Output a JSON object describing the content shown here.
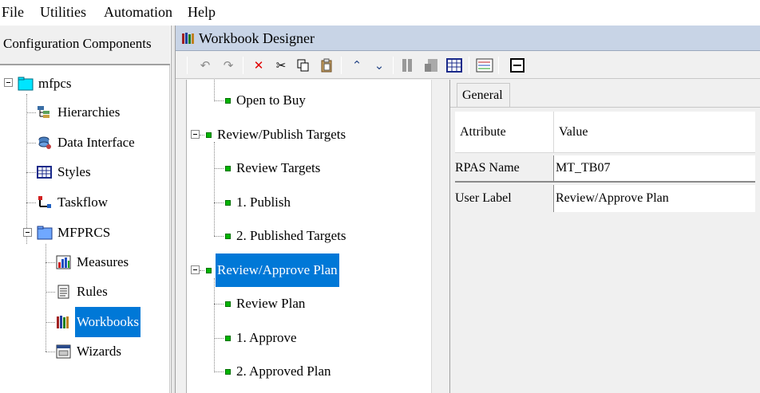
{
  "menu": {
    "file": "File",
    "utilities": "Utilities",
    "automation": "Automation",
    "help": "Help"
  },
  "left_panel": {
    "header": "Configuration Components",
    "items": [
      {
        "label": "mfpcs",
        "icon": "folder-icon"
      },
      {
        "label": "Hierarchies",
        "icon": "hierarchies-icon"
      },
      {
        "label": "Data Interface",
        "icon": "data-interface-icon"
      },
      {
        "label": "Styles",
        "icon": "styles-icon"
      },
      {
        "label": "Taskflow",
        "icon": "taskflow-icon"
      },
      {
        "label": "MFPRCS",
        "icon": "folder-icon"
      },
      {
        "label": "Measures",
        "icon": "measures-icon"
      },
      {
        "label": "Rules",
        "icon": "rules-icon"
      },
      {
        "label": "Workbooks",
        "icon": "workbooks-icon"
      },
      {
        "label": "Wizards",
        "icon": "wizards-icon"
      }
    ],
    "selected": "Workbooks"
  },
  "designer": {
    "title": "Workbook Designer",
    "toolbar": [
      "undo-icon",
      "redo-icon",
      "delete-icon",
      "cut-icon",
      "copy-icon",
      "paste-icon",
      "move-up-icon",
      "move-down-icon",
      "columns-icon",
      "layout-icon",
      "grid-icon",
      "properties-icon",
      "collapse-icon"
    ]
  },
  "workbook_tree": {
    "items": [
      {
        "label": "Open to Buy",
        "level": 2
      },
      {
        "label": "Review/Publish Targets",
        "level": 1
      },
      {
        "label": "Review Targets",
        "level": 2
      },
      {
        "label": "1. Publish",
        "level": 2
      },
      {
        "label": "2. Published Targets",
        "level": 2
      },
      {
        "label": "Review/Approve Plan",
        "level": 1
      },
      {
        "label": "Review Plan",
        "level": 2
      },
      {
        "label": "1. Approve",
        "level": 2
      },
      {
        "label": "2. Approved Plan",
        "level": 2
      }
    ],
    "selected": "Review/Approve Plan"
  },
  "properties": {
    "tab": "General",
    "headers": {
      "attribute": "Attribute",
      "value": "Value"
    },
    "rows": [
      {
        "attribute": "RPAS Name",
        "value": "MT_TB07"
      },
      {
        "attribute": "User Label",
        "value": "Review/Approve Plan"
      }
    ]
  },
  "colors": {
    "selection": "#0078d7",
    "title_bar": "#c8d4e6",
    "node_green": "#00b400"
  }
}
